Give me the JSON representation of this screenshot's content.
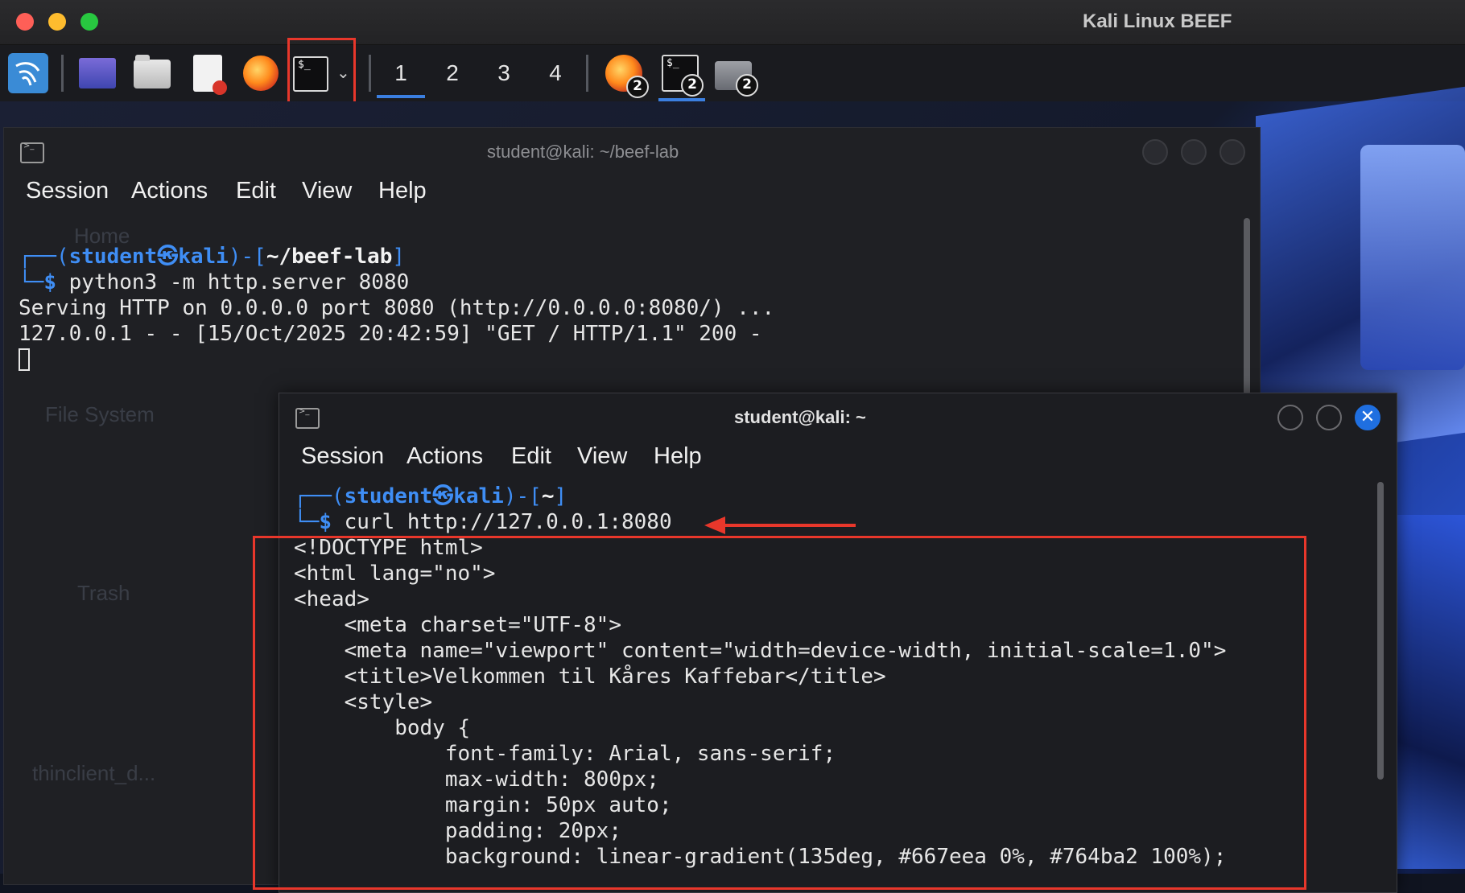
{
  "window": {
    "title": "Kali Linux BEEF"
  },
  "panel": {
    "workspaces": [
      "1",
      "2",
      "3",
      "4"
    ],
    "active_workspace": "1",
    "launcher_terminal_glyph": "$_",
    "tasks": [
      {
        "name": "firefox-task",
        "badge": "2"
      },
      {
        "name": "terminal-task",
        "badge": "2"
      },
      {
        "name": "files-task",
        "badge": "2"
      }
    ]
  },
  "desktop": {
    "labels": [
      "Home",
      "File System",
      "Trash",
      "thinclient_d..."
    ]
  },
  "terminal_back": {
    "title": "student@kali: ~/beef-lab",
    "menu": [
      "Session",
      "Actions",
      "Edit",
      "View",
      "Help"
    ],
    "prompt_user": "student",
    "prompt_at": "㉿",
    "prompt_host": "kali",
    "prompt_path": "~/beef-lab",
    "command": "python3 -m http.server 8080",
    "output": [
      "Serving HTTP on 0.0.0.0 port 8080 (http://0.0.0.0:8080/) ...",
      "127.0.0.1 - - [15/Oct/2025 20:42:59] \"GET / HTTP/1.1\" 200 -"
    ]
  },
  "terminal_front": {
    "title": "student@kali: ~",
    "menu": [
      "Session",
      "Actions",
      "Edit",
      "View",
      "Help"
    ],
    "prompt_user": "student",
    "prompt_at": "㉿",
    "prompt_host": "kali",
    "prompt_path": "~",
    "command": "curl http://127.0.0.1:8080",
    "output": [
      "<!DOCTYPE html>",
      "<html lang=\"no\">",
      "<head>",
      "    <meta charset=\"UTF-8\">",
      "    <meta name=\"viewport\" content=\"width=device-width, initial-scale=1.0\">",
      "    <title>Velkommen til Kåres Kaffebar</title>",
      "    <style>",
      "        body {",
      "            font-family: Arial, sans-serif;",
      "            max-width: 800px;",
      "            margin: 50px auto;",
      "            padding: 20px;",
      "            background: linear-gradient(135deg, #667eea 0%, #764ba2 100%);"
    ]
  },
  "colors": {
    "annotation_red": "#e8372b",
    "prompt_blue": "#3f8ef5",
    "close_blue": "#1f6fe0"
  }
}
